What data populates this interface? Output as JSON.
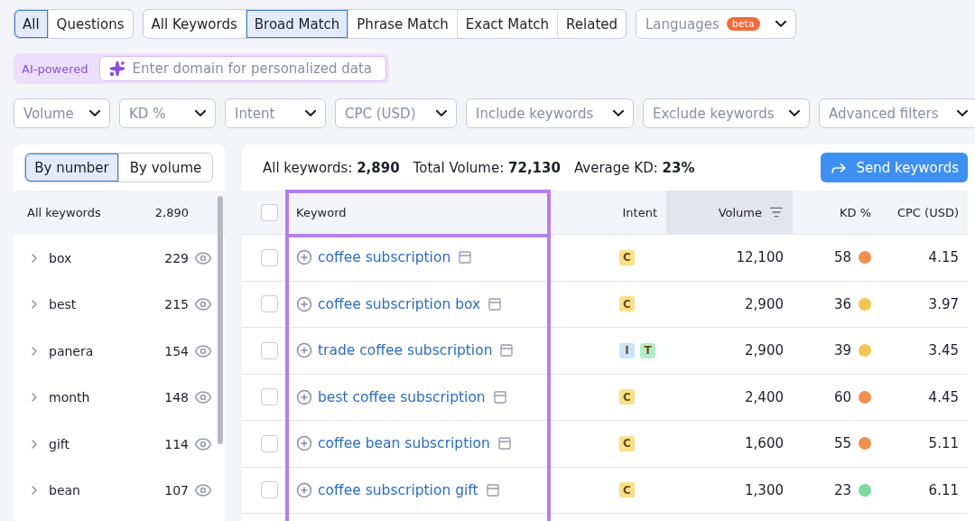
{
  "search_type_tabs": [
    {
      "label": "All",
      "selected": true
    },
    {
      "label": "Questions",
      "selected": false
    }
  ],
  "match_tabs": [
    {
      "label": "All Keywords",
      "selected": false
    },
    {
      "label": "Broad Match",
      "selected": true
    },
    {
      "label": "Phrase Match",
      "selected": false
    },
    {
      "label": "Exact Match",
      "selected": false
    },
    {
      "label": "Related",
      "selected": false
    }
  ],
  "languages": {
    "label": "Languages",
    "badge": "beta"
  },
  "ai_domain": {
    "tag": "AI-powered",
    "placeholder": "Enter domain for personalized data"
  },
  "filters": [
    "Volume",
    "KD %",
    "Intent",
    "CPC (USD)",
    "Include keywords",
    "Exclude keywords",
    "Advanced filters"
  ],
  "groups": {
    "toggle": [
      {
        "label": "By number",
        "selected": true
      },
      {
        "label": "By volume",
        "selected": false
      }
    ],
    "all": {
      "label": "All keywords",
      "count": "2,890"
    },
    "items": [
      {
        "label": "box",
        "count": "229"
      },
      {
        "label": "best",
        "count": "215"
      },
      {
        "label": "panera",
        "count": "154"
      },
      {
        "label": "month",
        "count": "148"
      },
      {
        "label": "gift",
        "count": "114"
      },
      {
        "label": "bean",
        "count": "107"
      }
    ]
  },
  "summary": [
    {
      "label": "All keywords:",
      "value": "2,890"
    },
    {
      "label": "Total Volume:",
      "value": "72,130"
    },
    {
      "label": "Average KD:",
      "value": "23%"
    }
  ],
  "send_button": "Send keywords",
  "table": {
    "select_all_checked": false,
    "columns": [
      {
        "label": "Keyword",
        "sorted": false
      },
      {
        "label": "Intent",
        "sorted": false
      },
      {
        "label": "Volume",
        "sorted": true
      },
      {
        "label": "KD %",
        "sorted": false
      },
      {
        "label": "CPC (USD)",
        "sorted": false
      }
    ],
    "rows": [
      {
        "checked": false,
        "keyword": "coffee subscription",
        "intents": [
          {
            "label": "C",
            "color": "#fbe08a"
          }
        ],
        "volume": "12,100",
        "kd": {
          "value": "58",
          "color": "#f0904f"
        },
        "cpc": "4.15"
      },
      {
        "checked": false,
        "keyword": "coffee subscription box",
        "intents": [
          {
            "label": "C",
            "color": "#fbe08a"
          }
        ],
        "volume": "2,900",
        "kd": {
          "value": "36",
          "color": "#f5c451"
        },
        "cpc": "3.97"
      },
      {
        "checked": false,
        "keyword": "trade coffee subscription",
        "intents": [
          {
            "label": "I",
            "color": "#cbe4fb"
          },
          {
            "label": "T",
            "color": "#b4ecc9"
          }
        ],
        "volume": "2,900",
        "kd": {
          "value": "39",
          "color": "#f5c451"
        },
        "cpc": "3.45"
      },
      {
        "checked": false,
        "keyword": "best coffee subscription",
        "intents": [
          {
            "label": "C",
            "color": "#fbe08a"
          }
        ],
        "volume": "2,400",
        "kd": {
          "value": "60",
          "color": "#f0904f"
        },
        "cpc": "4.45"
      },
      {
        "checked": false,
        "keyword": "coffee bean subscription",
        "intents": [
          {
            "label": "C",
            "color": "#fbe08a"
          }
        ],
        "volume": "1,600",
        "kd": {
          "value": "55",
          "color": "#f0904f"
        },
        "cpc": "5.11"
      },
      {
        "checked": false,
        "keyword": "coffee subscription gift",
        "intents": [
          {
            "label": "C",
            "color": "#fbe08a"
          }
        ],
        "volume": "1,300",
        "kd": {
          "value": "23",
          "color": "#7fd9a0"
        },
        "cpc": "6.11"
      }
    ]
  }
}
